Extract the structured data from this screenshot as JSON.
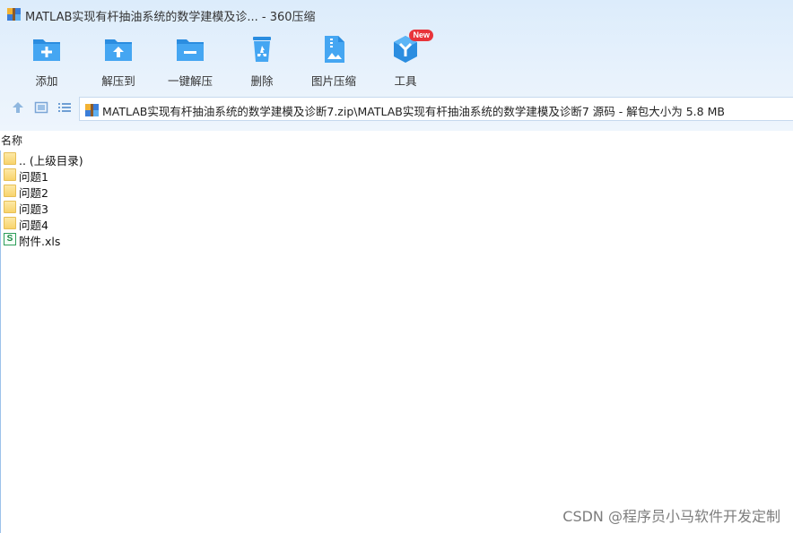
{
  "window": {
    "title": "MATLAB实现有杆抽油系统的数学建模及诊... - 360压缩"
  },
  "toolbar": {
    "items": [
      {
        "label": "添加",
        "icon": "folder-add-icon"
      },
      {
        "label": "解压到",
        "icon": "folder-extract-icon"
      },
      {
        "label": "一键解压",
        "icon": "folder-minus-icon"
      },
      {
        "label": "删除",
        "icon": "recycle-bin-icon"
      },
      {
        "label": "图片压缩",
        "icon": "image-compress-icon"
      },
      {
        "label": "工具",
        "icon": "tools-cube-icon",
        "badge": "New"
      }
    ]
  },
  "address": {
    "path": "MATLAB实现有杆抽油系统的数学建模及诊断7.zip\\MATLAB实现有杆抽油系统的数学建模及诊断7 源码 - 解包大小为 5.8 MB"
  },
  "list": {
    "column_name": "名称",
    "files": [
      {
        "name": ".. (上级目录)",
        "type": "folder"
      },
      {
        "name": "问题1",
        "type": "folder"
      },
      {
        "name": "问题2",
        "type": "folder"
      },
      {
        "name": "问题3",
        "type": "folder"
      },
      {
        "name": "问题4",
        "type": "folder"
      },
      {
        "name": "附件.xls",
        "type": "xls",
        "icon_letter": "S"
      }
    ]
  },
  "watermark": "CSDN @程序员小马软件开发定制",
  "colors": {
    "accent": "#2f8fe0",
    "header_bg": "#e3effb",
    "badge": "#e8343a"
  }
}
